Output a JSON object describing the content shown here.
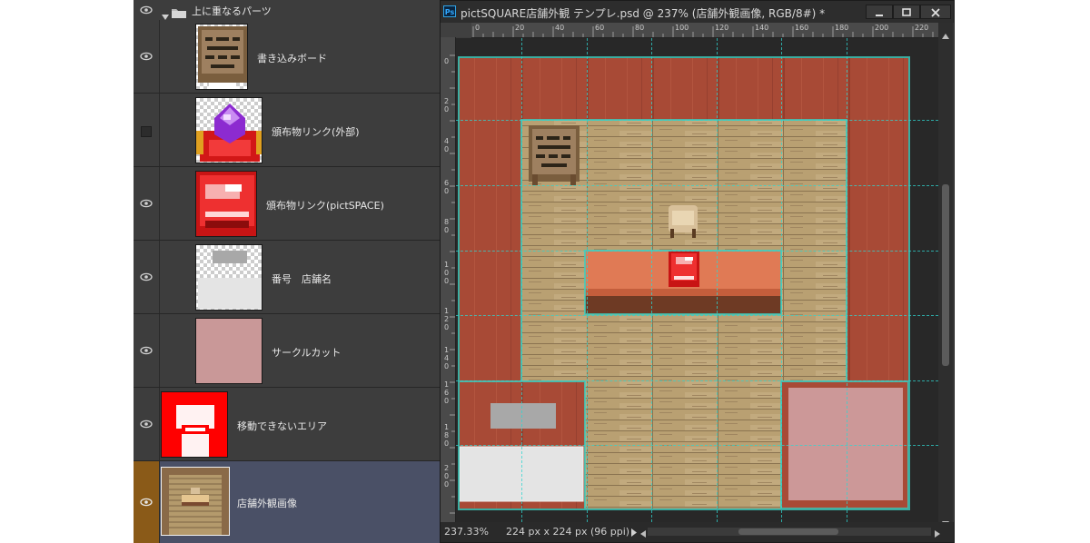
{
  "layers_panel": {
    "group_name": "上に重なるパーツ",
    "layers": [
      {
        "name": "書き込みボード",
        "visible": true,
        "thumb": "board"
      },
      {
        "name": "頒布物リンク(外部)",
        "visible": false,
        "thumb": "crystal"
      },
      {
        "name": "頒布物リンク(pictSPACE)",
        "visible": true,
        "thumb": "redbox"
      },
      {
        "name": "番号　店舗名",
        "visible": true,
        "thumb": "numberplate"
      },
      {
        "name": "サークルカット",
        "visible": true,
        "thumb": "pink"
      },
      {
        "name": "移動できないエリア",
        "visible": true,
        "thumb": "redarea"
      },
      {
        "name": "店舗外観画像",
        "visible": true,
        "thumb": "storefront",
        "selected": true
      }
    ]
  },
  "document": {
    "app_icon": "Ps",
    "title": "pictSQUARE店舗外観 テンプレ.psd @ 237% (店舗外観画像, RGB/8#) *",
    "ruler_top_labels": [
      "0",
      "20",
      "40",
      "60",
      "80",
      "100",
      "120",
      "140",
      "160",
      "180",
      "200",
      "220"
    ],
    "ruler_left_labels": [
      "0",
      "2\n0",
      "4\n0",
      "6\n0",
      "8\n0",
      "1\n0\n0",
      "1\n2\n0",
      "1\n4\n0",
      "1\n6\n0",
      "1\n8\n0",
      "2\n0\n0"
    ],
    "zoom": "237.33%",
    "doc_info": "224 px x 224 px (96 ppi)"
  },
  "colors": {
    "panel_bg": "#3d3d3d",
    "selected_row": "#4a5066",
    "floor_wood": "#b49a6c",
    "carpet_red": "#a84a36",
    "guide_cyan": "#2fd6d0",
    "counter_orange": "#e07a55"
  },
  "icons": {
    "visibility": "eye-icon",
    "folder": "folder-icon",
    "expand": "chevron-down-icon",
    "minimize": "minimize-icon",
    "maximize": "maximize-icon",
    "close": "close-icon"
  }
}
